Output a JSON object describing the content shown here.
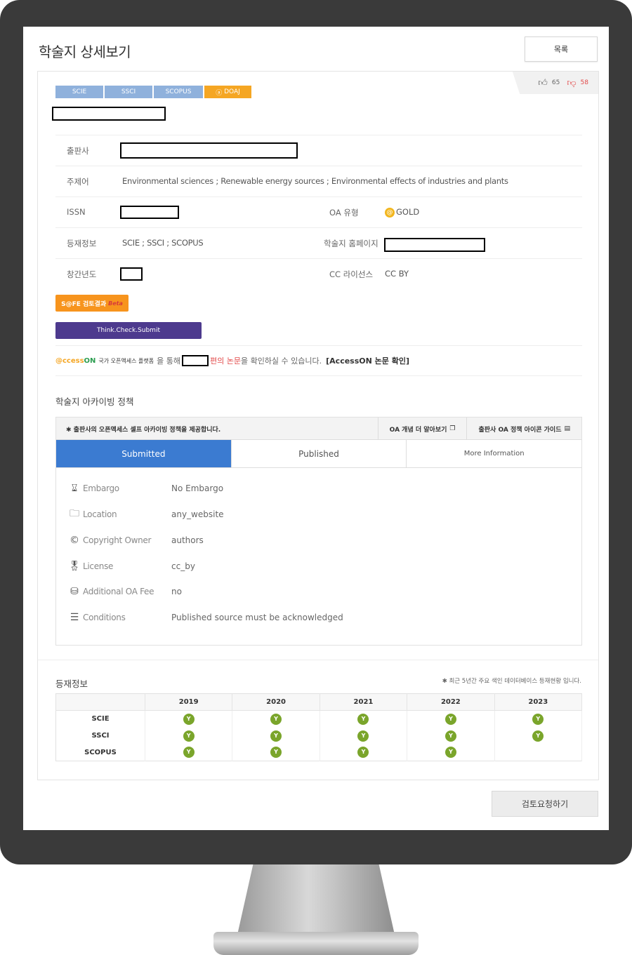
{
  "page": {
    "title": "학술지 상세보기",
    "list_button": "목록"
  },
  "tags": [
    {
      "label": "SCIE"
    },
    {
      "label": "SSCI"
    },
    {
      "label": "SCOPUS"
    },
    {
      "label": "DOAJ"
    }
  ],
  "votes": {
    "up": "65",
    "down": "58"
  },
  "info": {
    "publisher_label": "출판사",
    "subject_label": "주제어",
    "subject_value": "Environmental sciences ; Renewable energy sources ; Environmental effects of industries and plants",
    "issn_label": "ISSN",
    "oa_type_label": "OA 유형",
    "oa_type_value": "GOLD",
    "indexing_label": "등재정보",
    "indexing_value": "SCIE ; SSCI ; SCOPUS",
    "homepage_label": "학술지 홈페이지",
    "founded_label": "창간년도",
    "cc_label": "CC 라이선스",
    "cc_value": "CC BY"
  },
  "safe_button": {
    "label": "S@FE 검토결과",
    "beta": "Beta"
  },
  "tcs_button": {
    "label": "Think.Check.Submit"
  },
  "access_on": {
    "logo_prefix": "@ccess",
    "logo_on": "ON",
    "small": "국가 오픈액세스 플랫폼",
    "text1": "을 통해",
    "red": "편의 논문",
    "text2": "을 확인하실 수 있습니다.",
    "link": "[AccessON 논문 확인]"
  },
  "archive": {
    "title": "학술지 아카이빙 정책",
    "notice": "✱ 출판사의 오픈액세스 셀프 아카이빙 정책을 제공합니다.",
    "link1": "OA 개념 더 알아보기",
    "link2": "출판사 OA 정책 아이콘 가이드",
    "tabs": [
      "Submitted",
      "Published",
      "More Information"
    ],
    "rows": [
      {
        "label": "Embargo",
        "value": "No Embargo"
      },
      {
        "label": "Location",
        "value": "any_website"
      },
      {
        "label": "Copyright Owner",
        "value": "authors"
      },
      {
        "label": "License",
        "value": "cc_by"
      },
      {
        "label": "Additional OA Fee",
        "value": "no"
      },
      {
        "label": "Conditions",
        "value": "Published source must be acknowledged"
      }
    ]
  },
  "registration": {
    "title": "등재정보",
    "note": "✱ 최근 5년간 주요 색인 데이터베이스 등재현황 입니다.",
    "years": [
      "2019",
      "2020",
      "2021",
      "2022",
      "2023"
    ],
    "y_mark": "Y",
    "rows": [
      {
        "db": "SCIE",
        "marks": [
          true,
          true,
          true,
          true,
          true
        ]
      },
      {
        "db": "SSCI",
        "marks": [
          true,
          true,
          true,
          true,
          true
        ]
      },
      {
        "db": "SCOPUS",
        "marks": [
          true,
          true,
          true,
          true,
          false
        ]
      }
    ]
  },
  "review_button": "검토요청하기"
}
